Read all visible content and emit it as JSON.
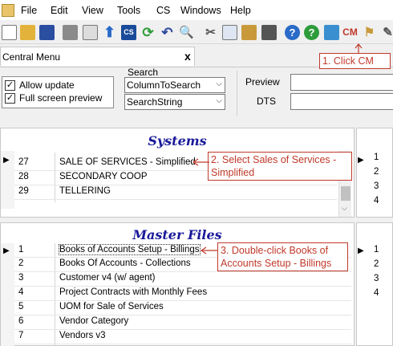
{
  "menu": {
    "items": [
      "File",
      "Edit",
      "View",
      "Tools",
      "CS",
      "Windows",
      "Help"
    ]
  },
  "toolbar": {
    "cm_label": "CM"
  },
  "tab": {
    "title": "Central Menu",
    "close": "x"
  },
  "options": {
    "allow_update": "Allow update",
    "full_screen_preview": "Full screen preview"
  },
  "search": {
    "label": "Search",
    "column_value": "ColumnToSearch",
    "string_value": "SearchString"
  },
  "preview": {
    "preview_label": "Preview",
    "dts_label": "DTS"
  },
  "systems": {
    "title": "Systems",
    "rows": [
      {
        "num": "27",
        "desc": "SALE OF SERVICES - Simplified"
      },
      {
        "num": "28",
        "desc": "SECONDARY COOP"
      },
      {
        "num": "29",
        "desc": "TELLERING"
      }
    ],
    "right_rows": [
      "1",
      "2",
      "3",
      "4"
    ]
  },
  "master": {
    "title": "Master Files",
    "rows": [
      {
        "num": "1",
        "desc": "Books  of Accounts Setup - Billings"
      },
      {
        "num": "2",
        "desc": "Books Of Accounts - Collections"
      },
      {
        "num": "3",
        "desc": "Customer v4 (w/ agent)"
      },
      {
        "num": "4",
        "desc": "Project Contracts with Monthly Fees"
      },
      {
        "num": "5",
        "desc": "UOM for Sale of Services"
      },
      {
        "num": "6",
        "desc": "Vendor Category"
      },
      {
        "num": "7",
        "desc": "Vendors v3"
      }
    ],
    "right_rows": [
      "1",
      "2",
      "3",
      "4"
    ]
  },
  "callouts": {
    "step1": "1. Click CM",
    "step2": "2. Select Sales of Services - Simplified",
    "step3": "3. Double-click Books of Accounts Setup - Billings"
  },
  "colors": {
    "title_blue": "#1a1a9a",
    "callout_red": "#c0392b"
  }
}
